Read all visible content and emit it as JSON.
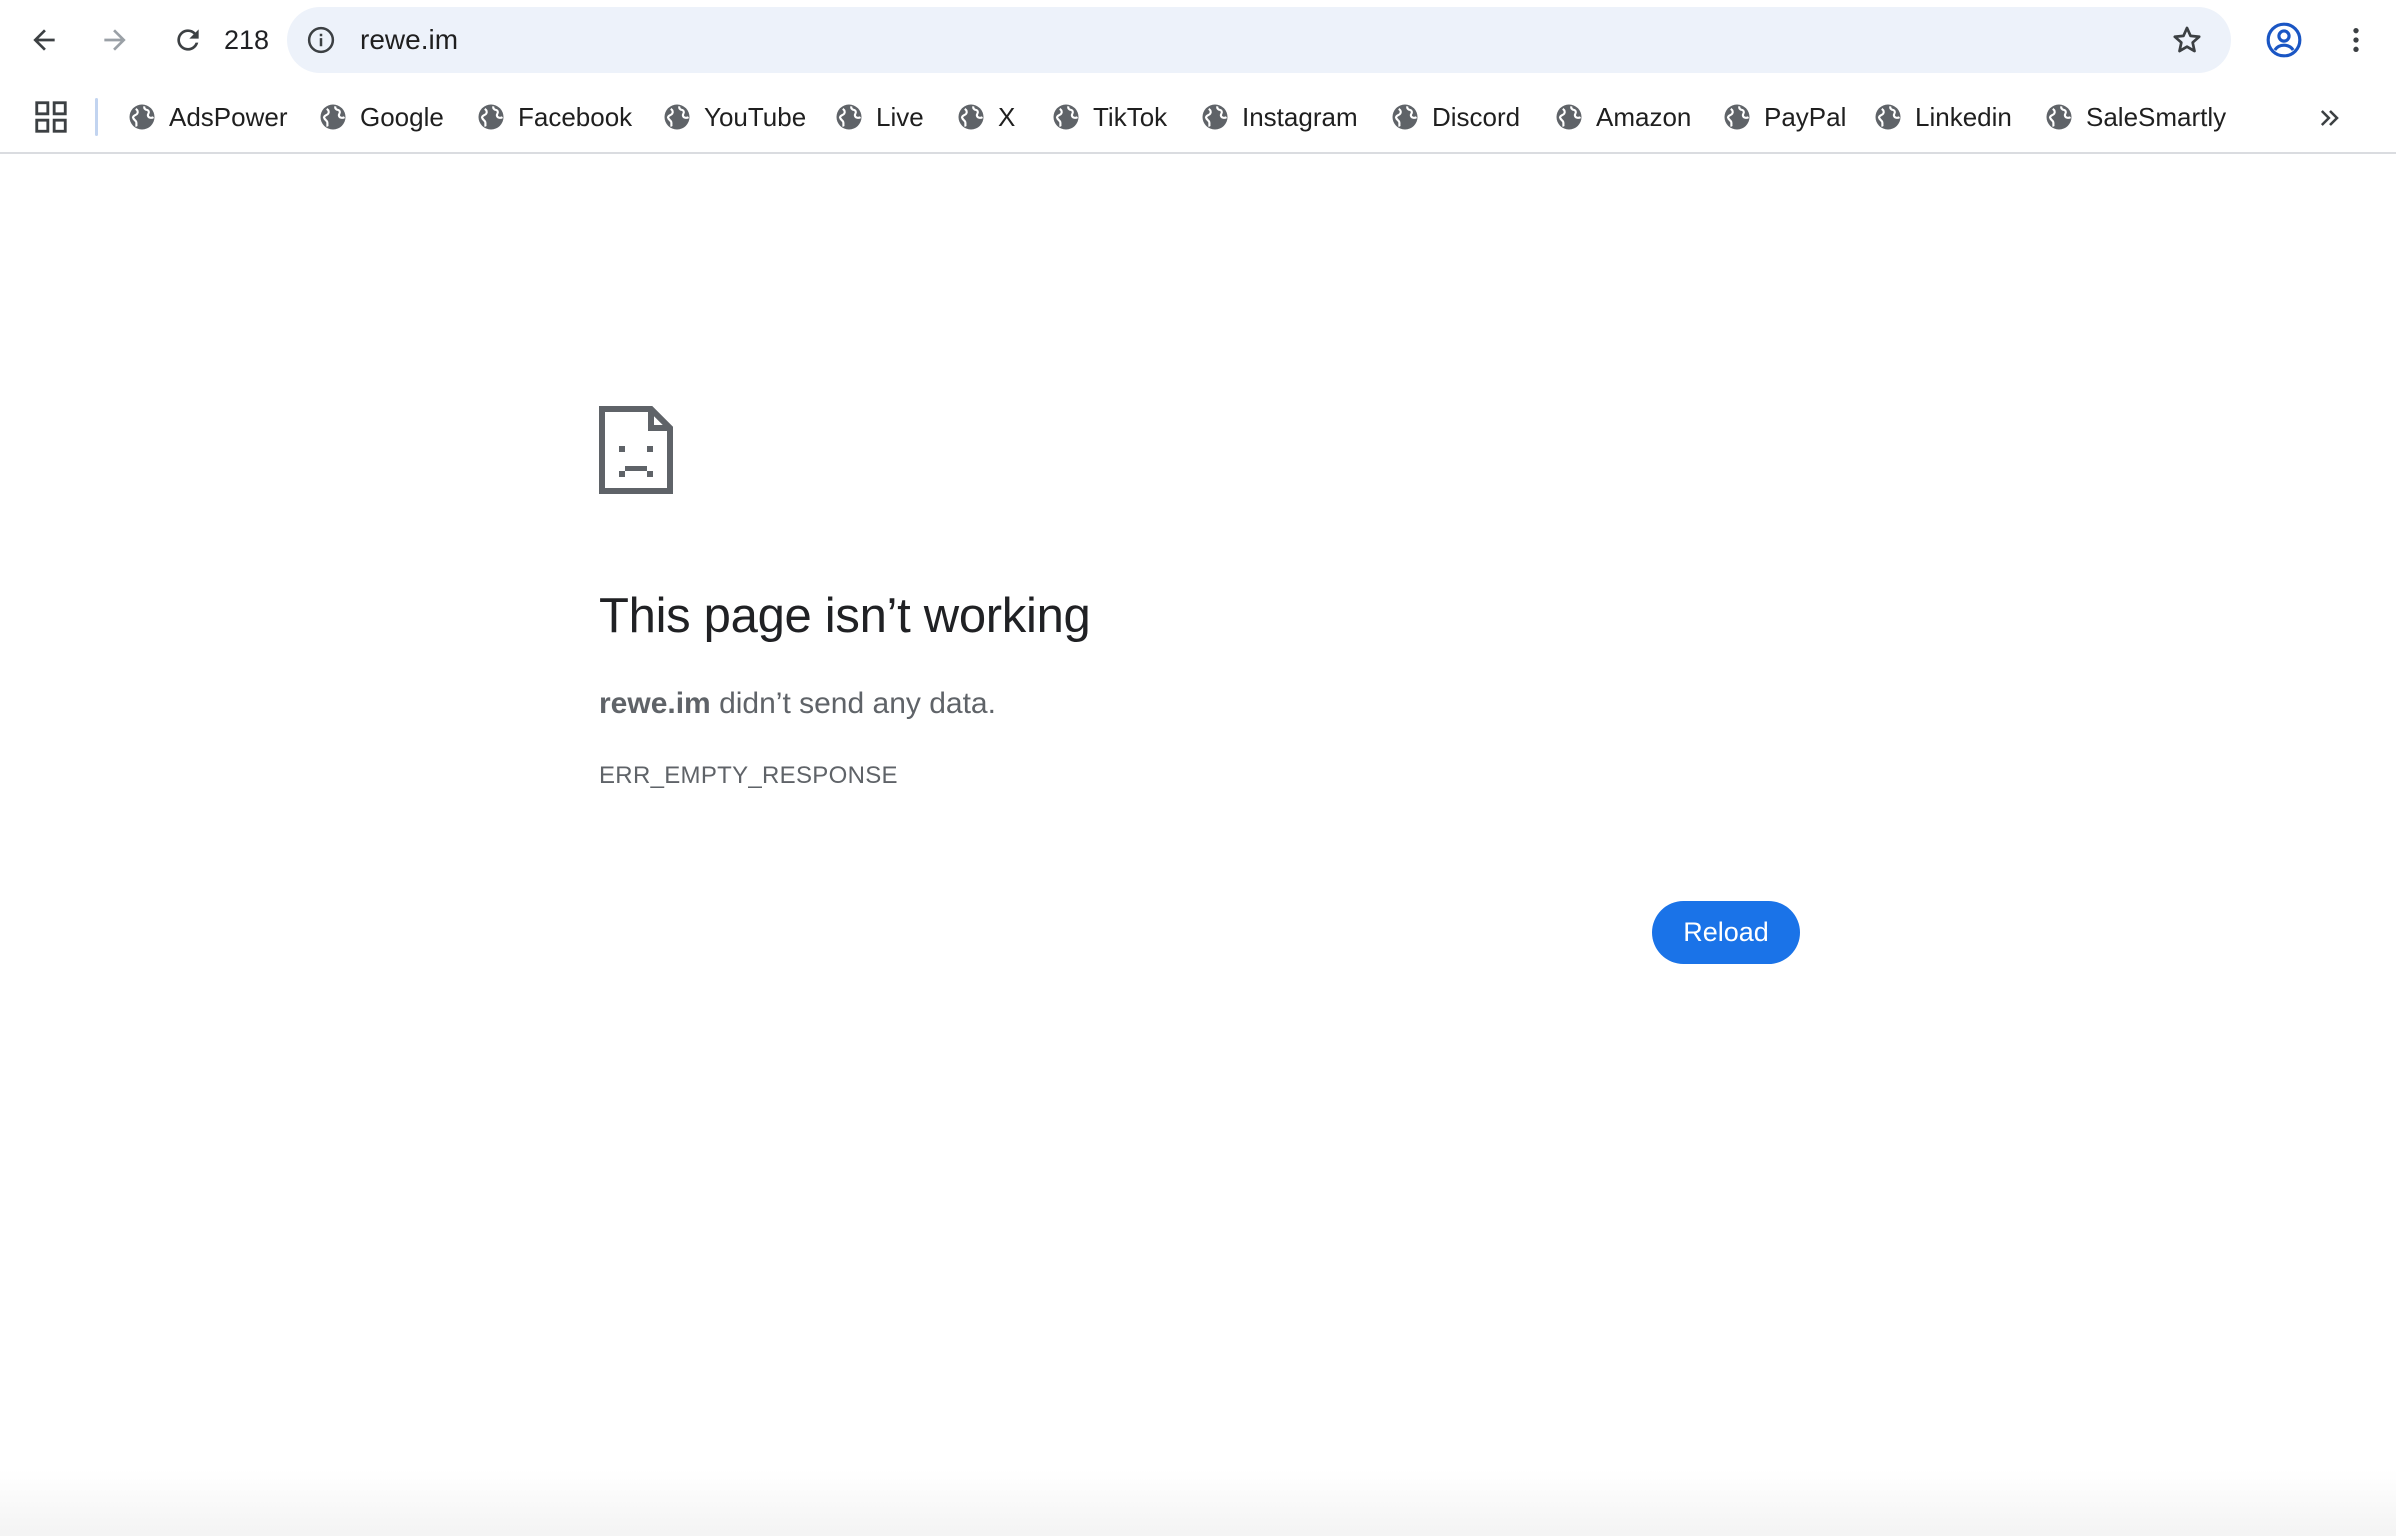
{
  "toolbar": {
    "tab_count": "218",
    "url": "rewe.im"
  },
  "bookmarks": {
    "items": [
      {
        "label": "AdsPower"
      },
      {
        "label": "Google"
      },
      {
        "label": "Facebook"
      },
      {
        "label": "YouTube"
      },
      {
        "label": "Live"
      },
      {
        "label": "X"
      },
      {
        "label": "TikTok"
      },
      {
        "label": "Instagram"
      },
      {
        "label": "Discord"
      },
      {
        "label": "Amazon"
      },
      {
        "label": "PayPal"
      },
      {
        "label": "Linkedin"
      },
      {
        "label": "SaleSmartly"
      }
    ]
  },
  "error": {
    "title": "This page isn’t working",
    "host": "rewe.im",
    "message": " didn’t send any data.",
    "code": "ERR_EMPTY_RESPONSE",
    "reload_label": "Reload"
  },
  "icons": {
    "back": "back-arrow-icon",
    "forward": "forward-arrow-icon",
    "reload": "reload-icon",
    "info": "info-icon",
    "star": "star-icon",
    "profile": "profile-icon",
    "menu": "kebab-menu-icon",
    "apps": "apps-grid-icon",
    "bookmark": "globe-icon",
    "more": "chevron-double-right-icon",
    "error": "sad-page-icon"
  },
  "colors": {
    "accent": "#1a73e8",
    "omnibox_bg": "#edf2fa",
    "text_secondary": "#5f6368"
  }
}
